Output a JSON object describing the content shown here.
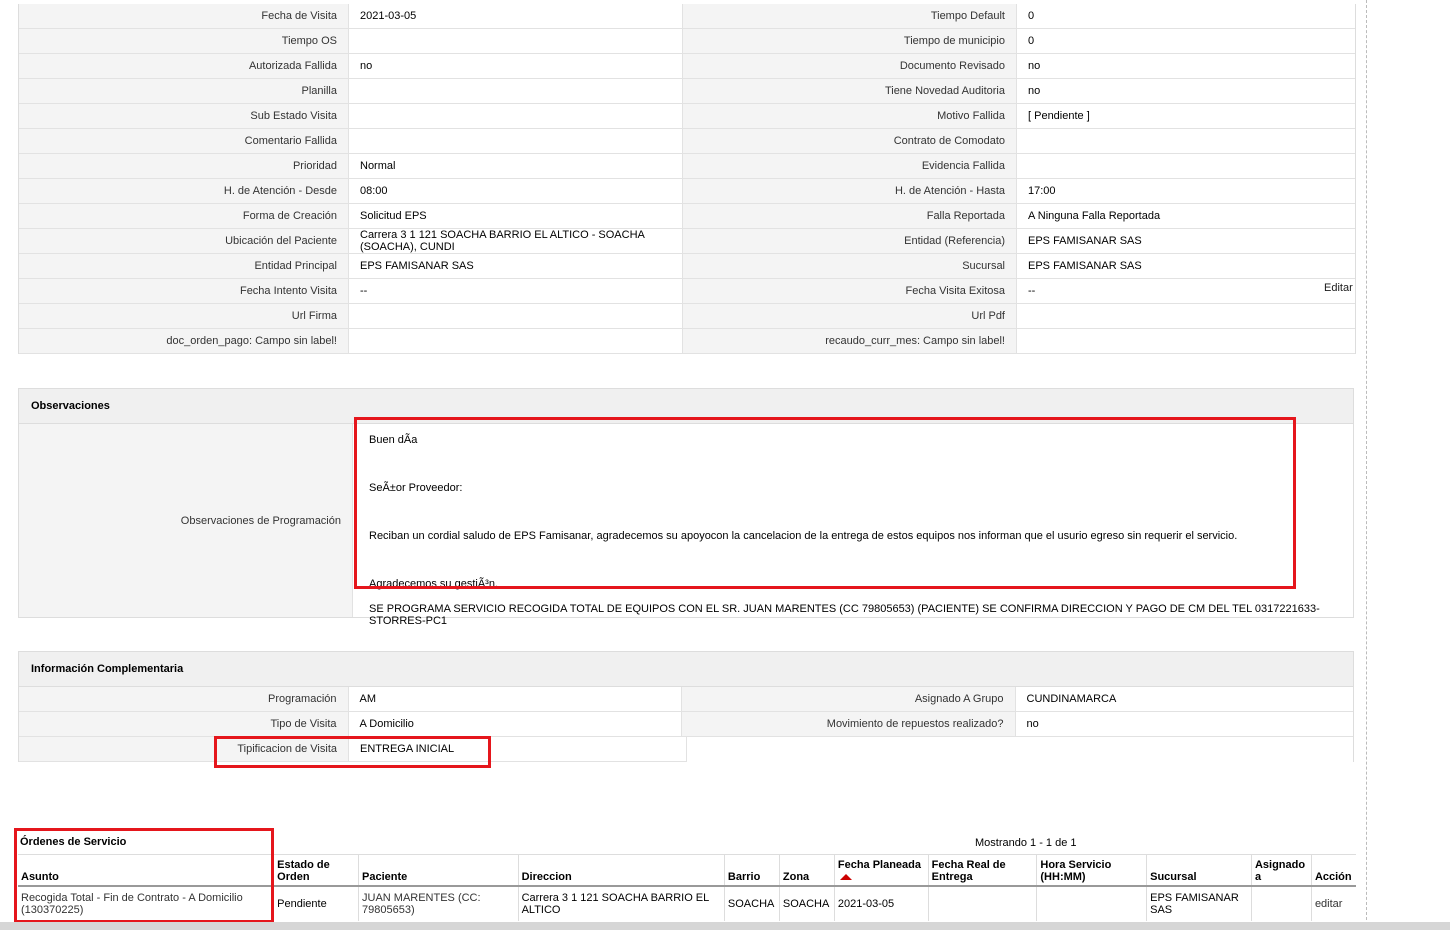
{
  "fields": [
    {
      "l1": "Fecha de Visita",
      "v1": "2021-03-05",
      "l2": "Tiempo Default",
      "v2": "0"
    },
    {
      "l1": "Tiempo OS",
      "v1": "",
      "l2": "Tiempo de municipio",
      "v2": "0"
    },
    {
      "l1": "Autorizada Fallida",
      "v1": "no",
      "l2": "Documento Revisado",
      "v2": "no"
    },
    {
      "l1": "Planilla",
      "v1": "",
      "l2": "Tiene Novedad Auditoria",
      "v2": "no"
    },
    {
      "l1": "Sub Estado Visita",
      "v1": "",
      "l2": "Motivo Fallida",
      "v2": "[ Pendiente ]"
    },
    {
      "l1": "Comentario Fallida",
      "v1": "",
      "l2": "Contrato de Comodato",
      "v2": ""
    },
    {
      "l1": "Prioridad",
      "v1": "Normal",
      "l2": "Evidencia Fallida",
      "v2": ""
    },
    {
      "l1": "H. de Atención - Desde",
      "v1": "08:00",
      "l2": "H. de Atención - Hasta",
      "v2": "17:00"
    },
    {
      "l1": "Forma de Creación",
      "v1": "Solicitud EPS",
      "l2": "Falla Reportada",
      "v2": "A Ninguna Falla Reportada"
    },
    {
      "l1": "Ubicación del Paciente",
      "v1": "Carrera 3 1 121 SOACHA BARRIO EL ALTICO - SOACHA (SOACHA), CUNDI",
      "l2": "Entidad (Referencia)",
      "v2": "EPS FAMISANAR SAS"
    },
    {
      "l1": "Entidad Principal",
      "v1": "EPS FAMISANAR SAS",
      "l2": "Sucursal",
      "v2": "EPS FAMISANAR SAS"
    },
    {
      "l1": "Fecha Intento Visita",
      "v1": "--",
      "l2": "Fecha Visita Exitosa",
      "v2": "--"
    },
    {
      "l1": "Url Firma",
      "v1": "",
      "l2": "Url Pdf",
      "v2": ""
    },
    {
      "l1": "doc_orden_pago: Campo sin label!",
      "v1": "",
      "l2": "recaudo_curr_mes: Campo sin label!",
      "v2": ""
    }
  ],
  "edit_link": "Editar",
  "observaciones": {
    "title": "Observaciones",
    "label": "Observaciones de Programación",
    "lines": [
      "Buen dÃ­a",
      "SeÃ±or Proveedor:",
      "Reciban un cordial saludo de EPS Famisanar, agradecemos su apoyocon la cancelacion de la entrega de estos equipos nos informan que el usurio egreso sin requerir el servicio.",
      "Agradecemos su gestiÃ³n."
    ],
    "note": "SE PROGRAMA SERVICIO RECOGIDA TOTAL DE EQUIPOS CON EL SR. JUAN MARENTES (CC 79805653) (PACIENTE) SE CONFIRMA DIRECCION Y PAGO DE CM DEL TEL 0317221633-STORRES-PC1"
  },
  "complementaria": {
    "title": "Información Complementaria",
    "rows": [
      {
        "l1": "Programación",
        "v1": "AM",
        "l2": "Asignado A Grupo",
        "v2": "CUNDINAMARCA"
      },
      {
        "l1": "Tipo de Visita",
        "v1": "A Domicilio",
        "l2": "Movimiento de repuestos realizado?",
        "v2": "no"
      }
    ],
    "tip_label": "Tipificacion de Visita",
    "tip_value": "ENTREGA INICIAL"
  },
  "orders": {
    "title": "Órdenes de Servicio",
    "showing": "Mostrando 1 - 1 de 1",
    "headers": {
      "asunto": "Asunto",
      "estado": "Estado de Orden",
      "paciente": "Paciente",
      "direccion": "Direccion",
      "barrio": "Barrio",
      "zona": "Zona",
      "fecha_plan": "Fecha Planeada",
      "fecha_real": "Fecha Real de Entrega",
      "hora": "Hora Servicio (HH:MM)",
      "sucursal": "Sucursal",
      "asignado": "Asignado a",
      "accion": "Acción"
    },
    "row": {
      "asunto": "Recogida Total - Fin de Contrato - A Domicilio (130370225)",
      "estado": "Pendiente",
      "paciente": "JUAN MARENTES (CC: 79805653)",
      "direccion": "Carrera 3 1 121 SOACHA BARRIO EL ALTICO",
      "barrio": "SOACHA",
      "zona": "SOACHA",
      "fecha_plan": "2021-03-05",
      "fecha_real": "",
      "hora": "",
      "sucursal": "EPS FAMISANAR SAS",
      "asignado": "",
      "accion": "editar"
    }
  }
}
